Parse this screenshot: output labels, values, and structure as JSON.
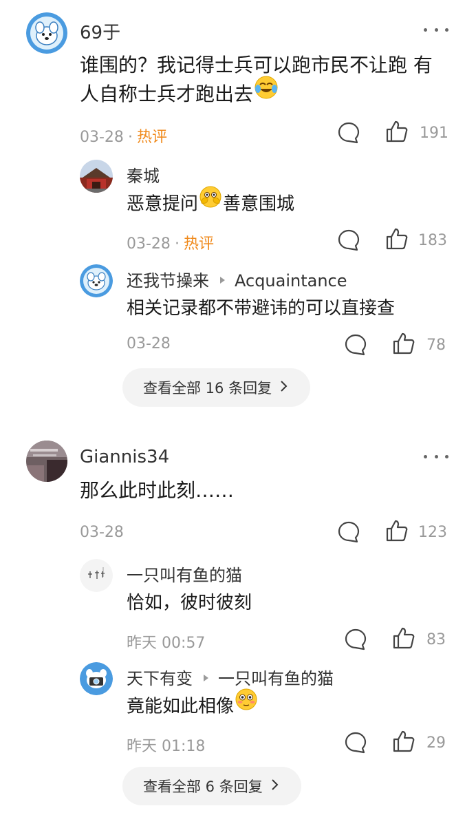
{
  "comments": [
    {
      "author": "69于",
      "text_line1": "谁围的？我记得士兵可以跑市民不让跑 有",
      "text_line2": "人自称士兵才跑出去",
      "emoji": "crying-laughing-emoji",
      "date": "03-28",
      "separator": "·",
      "hot_label": "热评",
      "likes": "191",
      "replies": [
        {
          "author": "秦城",
          "text_before": "恶意提问",
          "emoji": "peeking-face-emoji",
          "text_after": "善意围城",
          "date": "03-28",
          "separator": "·",
          "hot_label": "热评",
          "likes": "183"
        },
        {
          "author": "还我节操来",
          "reply_to": "Acquaintance",
          "text": "相关记录都不带避讳的可以直接查",
          "date": "03-28",
          "likes": "78"
        }
      ],
      "view_all": "查看全部 16 条回复"
    },
    {
      "author": "Giannis34",
      "text": "那么此时此刻……",
      "date": "03-28",
      "likes": "123",
      "replies": [
        {
          "author": "一只叫有鱼的猫",
          "text": "恰如，彼时彼刻",
          "date": "昨天 00:57",
          "likes": "83"
        },
        {
          "author": "天下有变",
          "reply_to": "一只叫有鱼的猫",
          "text": "竟能如此相像",
          "emoji": "flushed-face-emoji",
          "date": "昨天 01:18",
          "likes": "29"
        }
      ],
      "view_all": "查看全部 6 条回复"
    }
  ],
  "colors": {
    "hot": "#f08a1c",
    "meta": "#999999",
    "avatar_blue": "#4a9be0"
  }
}
